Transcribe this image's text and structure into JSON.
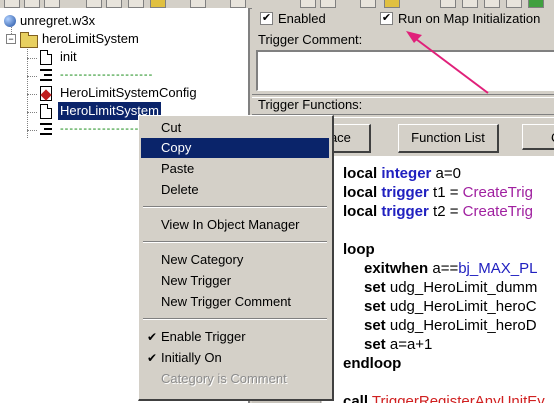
{
  "tree": {
    "root": {
      "label": "unregret.w3x"
    },
    "category": {
      "label": "heroLimitSystem"
    },
    "items": [
      {
        "label": "init",
        "kind": "trigger"
      },
      {
        "label": "--------------------",
        "kind": "comment"
      },
      {
        "label": "HeroLimitSystemConfig",
        "kind": "config"
      },
      {
        "label": "HeroLimitSystem",
        "kind": "trigger",
        "selected": true
      },
      {
        "label": "--------------------",
        "kind": "comment"
      }
    ]
  },
  "options": {
    "enabled_label": "Enabled",
    "enabled_checked": true,
    "run_on_init_label": "Run on Map Initialization",
    "run_on_init_checked": true
  },
  "comment": {
    "label": "Trigger Comment:",
    "value": ""
  },
  "functions": {
    "label": "Trigger Functions:",
    "replace_button": "lace",
    "function_list_button": "Function List",
    "extra_button": "C"
  },
  "code": {
    "l1_kw": "local",
    "l1_type": "integer",
    "l1_rest": " a=0",
    "l2_kw": "local",
    "l2_type": "trigger",
    "l2_var": " t1 = ",
    "l2_fn": "CreateTrig",
    "l3_kw": "local",
    "l3_type": "trigger",
    "l3_var": " t2 = ",
    "l3_fn": "CreateTrig",
    "l4_kw": "loop",
    "l5_kw": "exitwhen",
    "l5_var": " a==",
    "l5_const": "bj_MAX_PL",
    "l6_kw": "set",
    "l6_rest": " udg_HeroLimit_dumm",
    "l7_kw": "set",
    "l7_rest": " udg_HeroLimit_heroC",
    "l8_kw": "set",
    "l8_rest": " udg_HeroLimit_heroD",
    "l9_kw": "set",
    "l9_rest": " a=a+1",
    "l10_kw": "endloop",
    "l11_kw": "call",
    "l11_fn": " TriggerRegisterAnyUnitEv"
  },
  "context_menu": {
    "items": [
      {
        "label": "Cut"
      },
      {
        "label": "Copy",
        "highlighted": true
      },
      {
        "label": "Paste"
      },
      {
        "label": "Delete"
      },
      {
        "label": "View In Object Manager"
      },
      {
        "label": "New Category"
      },
      {
        "label": "New Trigger"
      },
      {
        "label": "New Trigger Comment"
      },
      {
        "label": "Enable Trigger",
        "checked": true
      },
      {
        "label": "Initially On",
        "checked": true
      },
      {
        "label": "Category is Comment",
        "disabled": true
      }
    ]
  },
  "annotation": {
    "arrow_color": "#e0207a"
  },
  "colors": {
    "selection": "#0a246a",
    "face": "#d4d0c8"
  }
}
